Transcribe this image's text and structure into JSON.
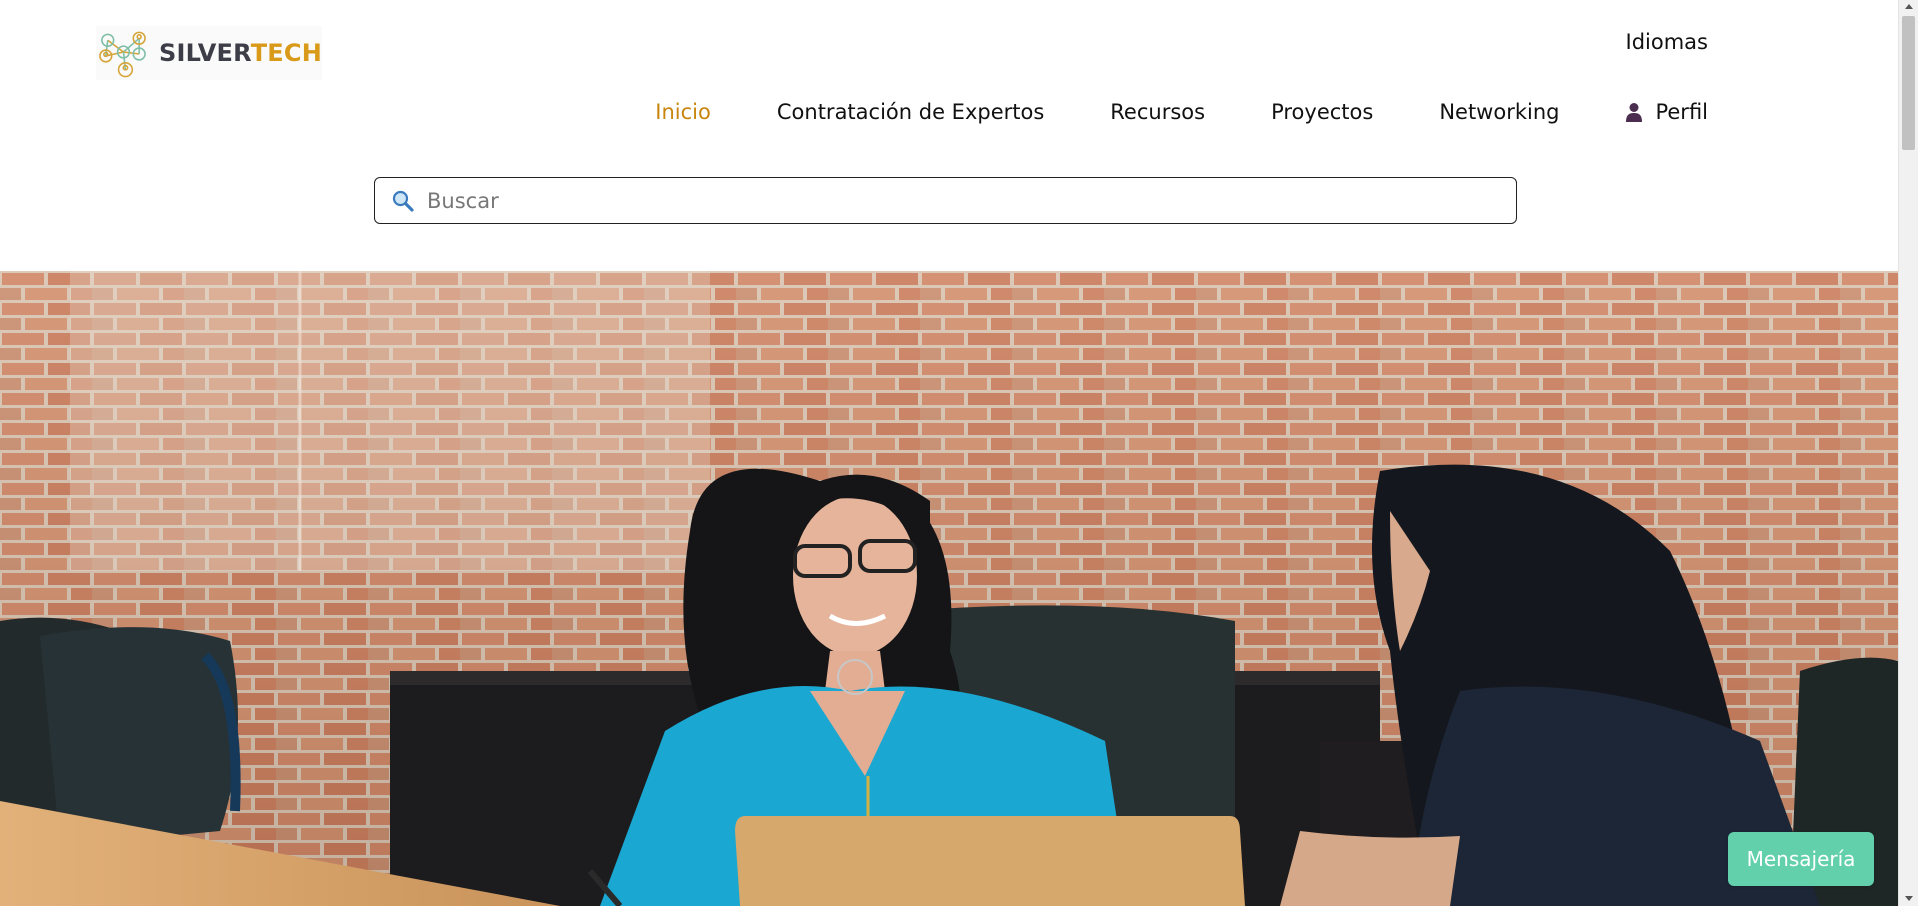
{
  "brand": {
    "name_part1": "SILVER",
    "name_part2": "TECH",
    "color_part1": "#3d3d47",
    "color_part2": "#d99a1a"
  },
  "header": {
    "languages_label": "Idiomas"
  },
  "nav": {
    "items": [
      {
        "label": "Inicio",
        "active": true
      },
      {
        "label": "Contratación de Expertos",
        "active": false
      },
      {
        "label": "Recursos",
        "active": false
      },
      {
        "label": "Proyectos",
        "active": false
      },
      {
        "label": "Networking",
        "active": false
      },
      {
        "label": "Perfil",
        "active": false,
        "icon": "user-icon"
      }
    ],
    "active_color": "#c8860e"
  },
  "search": {
    "placeholder": "Buscar",
    "value": "",
    "icon": "search-icon"
  },
  "hero": {
    "image": "photo of two women talking at a meeting table in front of a brick wall"
  },
  "messaging": {
    "label": "Mensajería",
    "color": "#63d0ac"
  }
}
